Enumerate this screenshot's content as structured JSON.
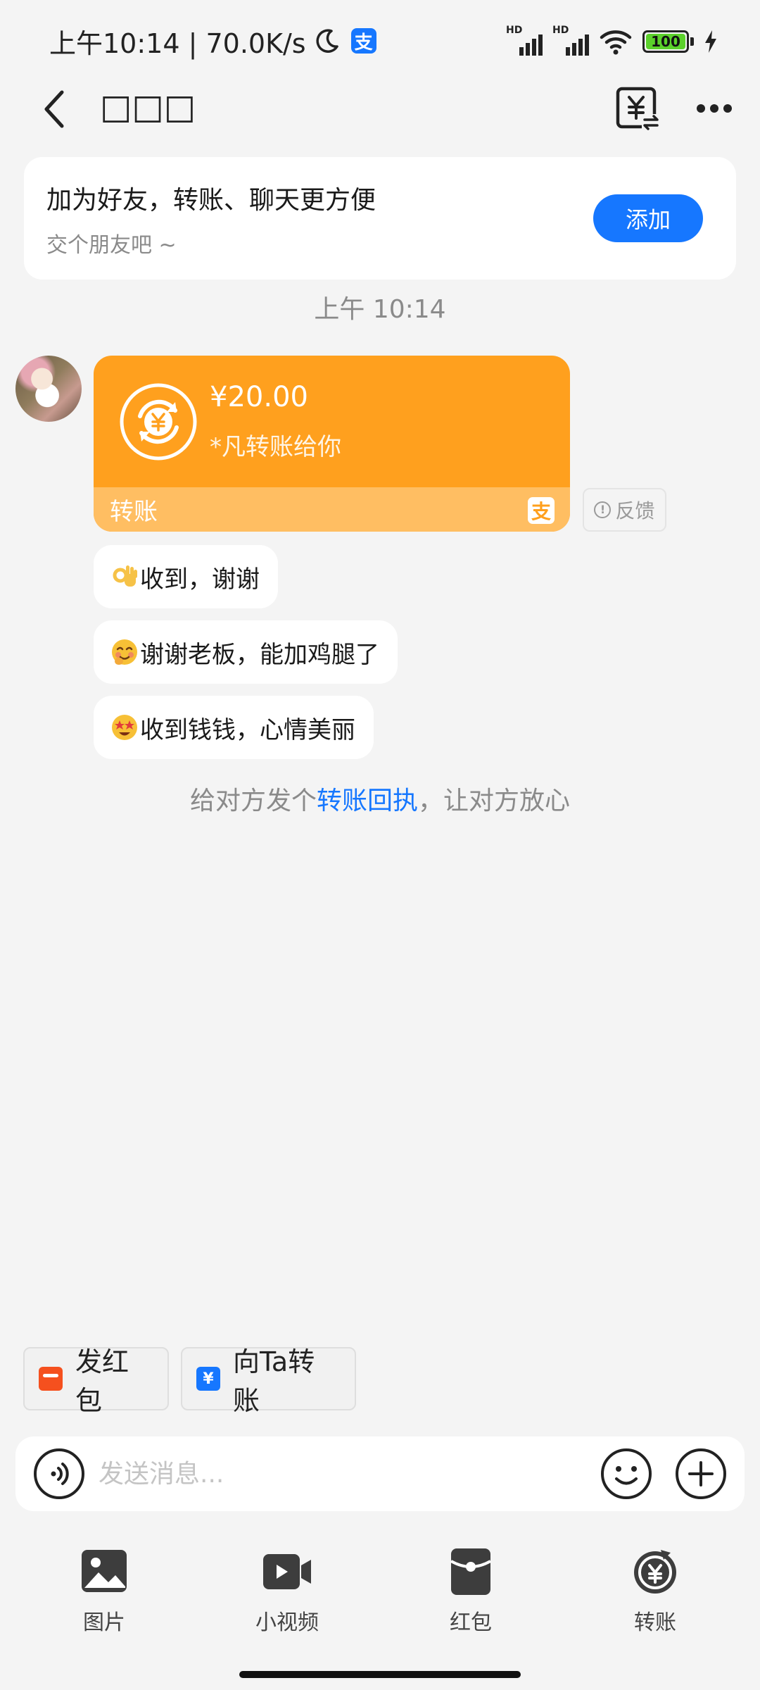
{
  "status_bar": {
    "time_speed": "上午10:14 | 70.0K/s",
    "hd_label": "HD",
    "battery_level": "100",
    "alipay_glyph": "支"
  },
  "header": {
    "title": "□□□"
  },
  "add_friend": {
    "title": "加为好友，转账、聊天更方便",
    "subtitle": "交个朋友吧 ~",
    "button": "添加"
  },
  "chat": {
    "timestamp": "上午 10:14",
    "transfer": {
      "amount": "¥20.00",
      "description": "*凡转账给你",
      "footer_label": "转账",
      "logo_glyph": "支",
      "feedback_label": "反馈",
      "feedback_icon_glyph": "!"
    },
    "messages": [
      {
        "emoji": "ok-hand-icon",
        "text": "收到，谢谢"
      },
      {
        "emoji": "blushing-face-icon",
        "text": "谢谢老板，能加鸡腿了"
      },
      {
        "emoji": "star-struck-face-icon",
        "text": "收到钱钱，心情美丽"
      }
    ],
    "receipt_hint": {
      "prefix": "给对方发个",
      "link": "转账回执",
      "suffix": "，让对方放心"
    }
  },
  "quick_actions": {
    "red_packet": "发红包",
    "transfer_to": "向Ta转账",
    "transfer_glyph": "¥"
  },
  "input": {
    "placeholder": "发送消息...",
    "value": ""
  },
  "tools": [
    {
      "label": "图片",
      "icon": "image-icon"
    },
    {
      "label": "小视频",
      "icon": "video-icon"
    },
    {
      "label": "红包",
      "icon": "red-packet-icon"
    },
    {
      "label": "转账",
      "icon": "transfer-icon"
    }
  ],
  "colors": {
    "accent": "#1677ff",
    "transfer_card": "#ffa01e",
    "transfer_footer": "#ffbe62",
    "background": "#f4f4f4"
  }
}
